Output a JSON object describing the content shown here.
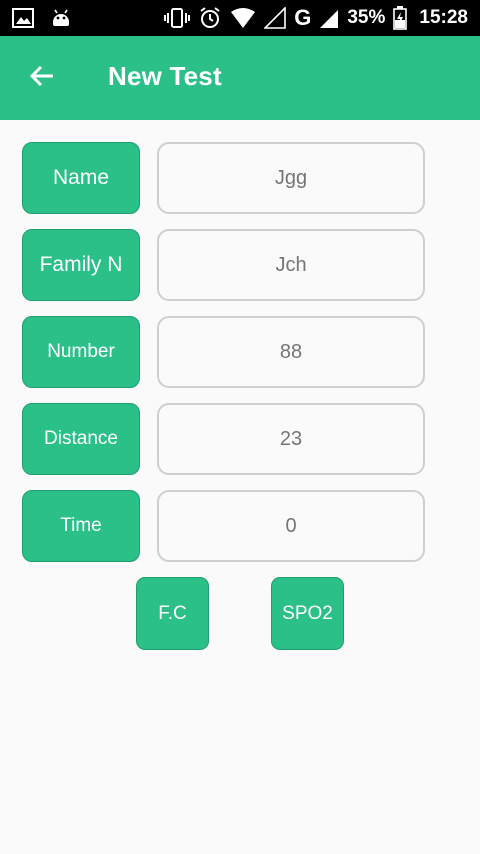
{
  "status_bar": {
    "battery": "35%",
    "time": "15:28",
    "network": "G",
    "icons": [
      "image-icon",
      "android-icon",
      "vibrate-icon",
      "alarm-icon",
      "wifi-icon",
      "signal-icon",
      "battery-icon"
    ]
  },
  "app_bar": {
    "title": "New Test",
    "back_icon": "arrow-left-icon",
    "color": "#2bc088"
  },
  "form": {
    "rows": [
      {
        "label": "Name",
        "value": "Jgg"
      },
      {
        "label": "Family N",
        "value": "Jch"
      },
      {
        "label": "Number",
        "value": "88"
      },
      {
        "label": "Distance",
        "value": "23"
      },
      {
        "label": "Time",
        "value": "0"
      }
    ]
  },
  "actions": {
    "fc_label": "F.C",
    "spo2_label": "SPO2"
  },
  "colors": {
    "accent": "#2bc088",
    "background": "#fafafa",
    "field_border": "#cfcfcf",
    "field_text": "#757575"
  }
}
